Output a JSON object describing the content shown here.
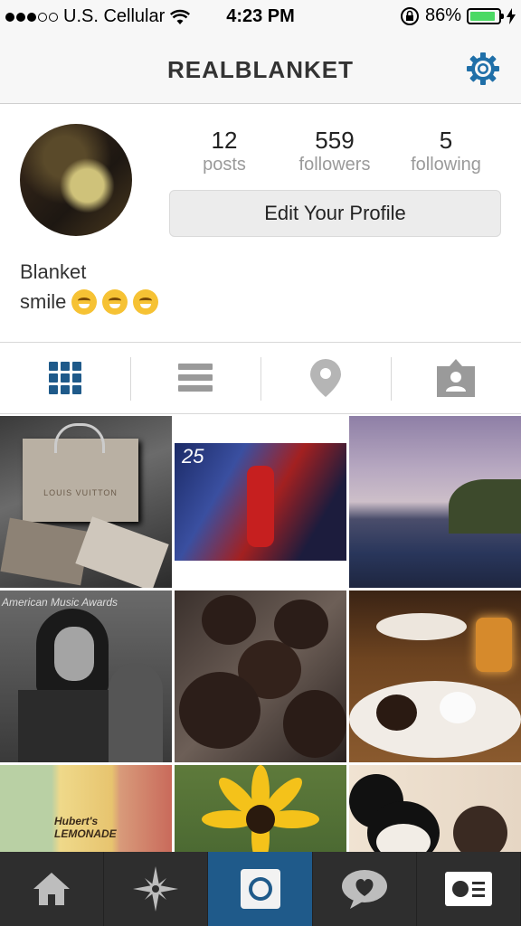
{
  "status_bar": {
    "carrier": "U.S. Cellular",
    "time": "4:23 PM",
    "battery": "86%"
  },
  "nav": {
    "title": "REALBLANKET",
    "settings_icon": "gear-icon"
  },
  "profile": {
    "stats": [
      {
        "num": "12",
        "label": "posts"
      },
      {
        "num": "559",
        "label": "followers"
      },
      {
        "num": "5",
        "label": "following"
      }
    ],
    "edit_button": "Edit Your Profile",
    "name": "Blanket",
    "bio": "smile"
  },
  "tabs": [
    "grid-icon",
    "list-icon",
    "location-pin-icon",
    "tagged-person-icon"
  ],
  "grid": {
    "photos": [
      {
        "name": "photo-louis-vuitton-bags",
        "text": "LOUIS VUITTON"
      },
      {
        "name": "photo-thriller-album-art",
        "text": "25"
      },
      {
        "name": "photo-infinity-pool",
        "text": ""
      },
      {
        "name": "photo-american-music-awards",
        "text": "American Music Awards"
      },
      {
        "name": "photo-chocolate-cake-pops",
        "text": ""
      },
      {
        "name": "photo-dessert-plate",
        "text": ""
      },
      {
        "name": "photo-huberts-lemonade",
        "text": "Hubert's LEMONADE"
      },
      {
        "name": "photo-sunflower",
        "text": ""
      },
      {
        "name": "photo-mickey-mouse",
        "text": ""
      }
    ]
  },
  "tabbar": [
    "home-icon",
    "explore-icon",
    "camera-icon",
    "activity-icon",
    "profile-icon"
  ],
  "colors": {
    "accent": "#1f5a8a",
    "battery_green": "#4cd964",
    "tabbar_bg": "#2e2e2e"
  }
}
